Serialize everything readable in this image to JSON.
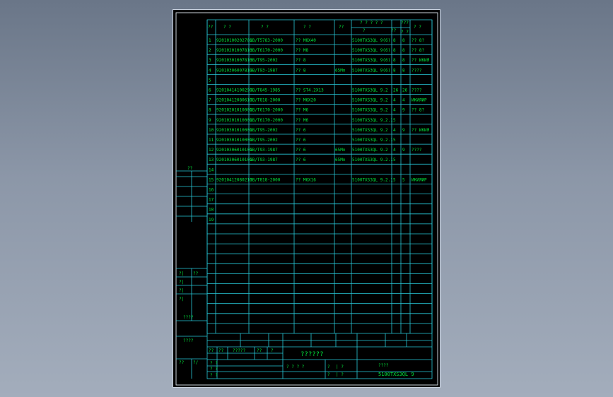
{
  "drawing": {
    "header": {
      "seq": "??",
      "code": "?  ?",
      "name": "?  ?",
      "spec": "?    ?",
      "qty": "??",
      "group_top": "? ? ? ? ?",
      "group_sub": "?",
      "unit_top": "???",
      "unit_sub": "??",
      "unit_sub2": "? ?",
      "total": "??",
      "remark": "?  ?"
    },
    "rows": [
      {
        "no": "1",
        "code": "92010100202781",
        "std": "GB/T5783-2000",
        "spec": "?? M8X40",
        "mat": "",
        "part": "5100TXS3QL 9(6)",
        "q1": "8",
        "q2": "8",
        "note": "?? 8?"
      },
      {
        "no": "2",
        "code": "92010201007810",
        "std": "GB/T6170-2000",
        "spec": "?? M8",
        "mat": "",
        "part": "5100TXS3QL 9(6)",
        "q1": "8",
        "q2": "8",
        "note": "?? 8?"
      },
      {
        "no": "3",
        "code": "92010301007810",
        "std": "GB/T95-2002",
        "spec": "?? 8",
        "mat": "",
        "part": "5100TXS3QL 9(6)",
        "q1": "8",
        "q2": "8",
        "note": "?? ИКИЯ"
      },
      {
        "no": "4",
        "code": "92010306007810",
        "std": "GB/T93-1987",
        "spec": "?? 8",
        "mat": "65Mn",
        "part": "5100TXS3QL 9(6)",
        "q1": "8",
        "q2": "8",
        "note": "????"
      },
      {
        "no": "5",
        "code": "",
        "std": "",
        "spec": "",
        "mat": "",
        "part": "",
        "q1": "",
        "q2": "",
        "note": ""
      },
      {
        "no": "6",
        "code": "92010414100290",
        "std": "GB/T845-1985",
        "spec": "?? ST4.2X13",
        "mat": "",
        "part": "5100TXS3QL 9.2",
        "q1": "26",
        "q2": "26",
        "note": "????"
      },
      {
        "no": "7",
        "code": "92010412080610",
        "std": "GB/T818-2000",
        "spec": "?? M6X20",
        "mat": "",
        "part": "5100TXS3QL 9.2",
        "q1": "4",
        "q2": "4",
        "note": "ИКИЯИР"
      },
      {
        "no": "8",
        "code": "92010201010001",
        "std": "GB/T6170-2000",
        "spec": "?? M6",
        "mat": "",
        "part": "5100TXS3QL 9.2",
        "q1": "4",
        "q2": "9",
        "note": "?? 8?"
      },
      {
        "no": "9",
        "code": "92010201010001",
        "std": "GB/T6170-2000",
        "spec": "?? M6",
        "mat": "",
        "part": "5100TXS3QL 9.2.1",
        "q1": "5",
        "q2": "",
        "note": ""
      },
      {
        "no": "10",
        "code": "92010301010001",
        "std": "GB/T95-2002",
        "spec": "?? 6",
        "mat": "",
        "part": "5100TXS3QL 9.2",
        "q1": "4",
        "q2": "9",
        "note": "?? ИКИЯ"
      },
      {
        "no": "11",
        "code": "92010301010001",
        "std": "GB/T95-2002",
        "spec": "?? 6",
        "mat": "",
        "part": "5100TXS3QL 9.2.1",
        "q1": "5",
        "q2": "",
        "note": ""
      },
      {
        "no": "12",
        "code": "92010306010101",
        "std": "GB/T93-1987",
        "spec": "?? 6",
        "mat": "65Mn",
        "part": "5100TXS3QL 9.2",
        "q1": "4",
        "q2": "9",
        "note": "????"
      },
      {
        "no": "13",
        "code": "92010306010101",
        "std": "GB/T93-1987",
        "spec": "?? 6",
        "mat": "65Mn",
        "part": "5100TXS3QL 9.2.1",
        "q1": "5",
        "q2": "",
        "note": ""
      },
      {
        "no": "14",
        "code": "",
        "std": "",
        "spec": "",
        "mat": "",
        "part": "",
        "q1": "",
        "q2": "",
        "note": ""
      },
      {
        "no": "15",
        "code": "92010412080210",
        "std": "GB/T818-2000",
        "spec": "?? M6X16",
        "mat": "",
        "part": "5100TXS3QL 9.2.1",
        "q1": "5",
        "q2": "5",
        "note": "ИКИЯИР"
      },
      {
        "no": "16",
        "code": "",
        "std": "",
        "spec": "",
        "mat": "",
        "part": "",
        "q1": "",
        "q2": "",
        "note": ""
      },
      {
        "no": "17",
        "code": "",
        "std": "",
        "spec": "",
        "mat": "",
        "part": "",
        "q1": "",
        "q2": "",
        "note": ""
      },
      {
        "no": "18",
        "code": "",
        "std": "",
        "spec": "",
        "mat": "",
        "part": "",
        "q1": "",
        "q2": "",
        "note": ""
      },
      {
        "no": "19",
        "code": "",
        "std": "",
        "spec": "",
        "mat": "",
        "part": "",
        "q1": "",
        "q2": "",
        "note": ""
      }
    ],
    "left_strip": {
      "top_label": "??",
      "sign_a": "?|",
      "sign_b": "?|",
      "sign_c": "?|",
      "sign_d": "?|",
      "sign_e": "??",
      "sign_f": "??",
      "date": "????",
      "code2": "????",
      "bottom_a": "??",
      "bottom_b": "?/"
    },
    "title_block": {
      "h1": "?? ",
      "h2": "?? ",
      "h3": "?????",
      "h4": "?? ",
      "h5": "? ",
      "r1": "? ?",
      "r2": "? ?",
      "r3": "? ?",
      "center_title": "??????",
      "sub1": "? ? ? ?",
      "sub2": "?",
      "sub3": "| ?",
      "sub4": "?",
      "sub5": "| ?",
      "right_label": "????",
      "drawing_no": "5100TXS3QL 9"
    }
  }
}
